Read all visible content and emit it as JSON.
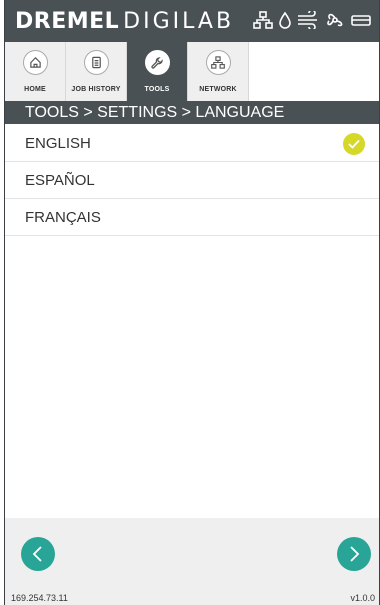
{
  "header": {
    "brand_primary": "DREMEL",
    "brand_secondary": "DIGILAB",
    "status_icons": [
      "network-icon",
      "drop-icon",
      "wind-icon",
      "fan-icon",
      "bed-icon"
    ]
  },
  "tabs": [
    {
      "label": "HOME",
      "icon": "home-icon",
      "active": false
    },
    {
      "label": "JOB HISTORY",
      "icon": "job-history-icon",
      "active": false
    },
    {
      "label": "TOOLS",
      "icon": "wrench-icon",
      "active": true
    },
    {
      "label": "NETWORK",
      "icon": "network-icon",
      "active": false
    }
  ],
  "breadcrumb": "TOOLS > SETTINGS > LANGUAGE",
  "languages": [
    {
      "label": "ENGLISH",
      "selected": true
    },
    {
      "label": "ESPAÑOL",
      "selected": false
    },
    {
      "label": "FRANÇAIS",
      "selected": false
    }
  ],
  "footer": {
    "ip_address": "169.254.73.11",
    "version": "v1.0.0"
  },
  "colors": {
    "header_bg": "#4a5154",
    "accent_teal": "#28a596",
    "check_yellow": "#d6d827"
  }
}
